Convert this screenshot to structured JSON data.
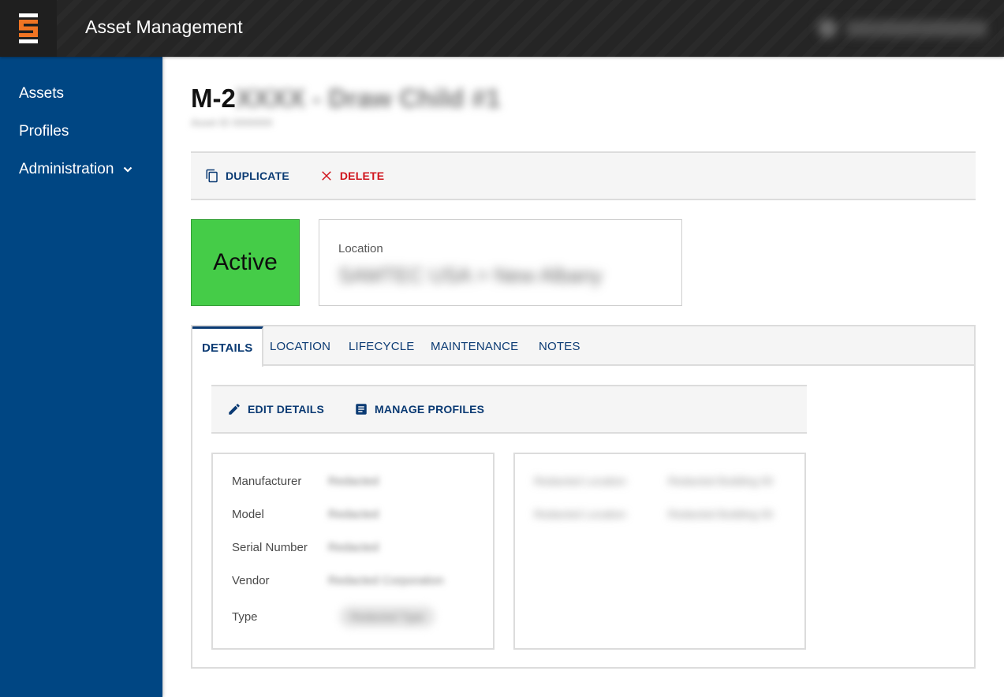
{
  "header": {
    "app_title": "Asset Management",
    "logo_letter": "S",
    "user_name": "User Name (redacted)"
  },
  "colors": {
    "topbar": "#252525",
    "sidebar": "#004683",
    "logo_orange": "#f07423",
    "primary_text": "#0a3a73",
    "danger": "#d0141c",
    "status_active": "#45cc48"
  },
  "sidebar": {
    "items": [
      {
        "label": "Assets",
        "icon": ""
      },
      {
        "label": "Profiles",
        "icon": ""
      },
      {
        "label": "Administration",
        "icon": "chevron-down-icon"
      }
    ]
  },
  "asset": {
    "title_prefix": "M-2",
    "title_redacted": "XXXX - Draw Child #1",
    "subtitle_redacted": "Asset ID 0000000"
  },
  "actions": {
    "duplicate_label": "DUPLICATE",
    "delete_label": "DELETE"
  },
  "status": {
    "label": "Active"
  },
  "location": {
    "label": "Location",
    "value_redacted": "SAMTEC USA > New Albany"
  },
  "tabs": [
    {
      "label": "DETAILS",
      "active": true
    },
    {
      "label": "LOCATION",
      "active": false
    },
    {
      "label": "LIFECYCLE",
      "active": false
    },
    {
      "label": "MAINTENANCE",
      "active": false
    },
    {
      "label": "NOTES",
      "active": false
    }
  ],
  "details_actions": {
    "edit_label": "EDIT DETAILS",
    "manage_profiles_label": "MANAGE PROFILES"
  },
  "details": {
    "fields": [
      {
        "label": "Manufacturer",
        "value": "Redacted"
      },
      {
        "label": "Model",
        "value": "Redacted"
      },
      {
        "label": "Serial Number",
        "value": "Redacted"
      },
      {
        "label": "Vendor",
        "value": "Redacted Corporation"
      },
      {
        "label": "Type",
        "value": "Redacted Type"
      }
    ],
    "extra_fields": [
      {
        "label": "Redacted Location",
        "value": "Redacted Building 00"
      },
      {
        "label": "Redacted Location",
        "value": "Redacted Building 00"
      }
    ]
  }
}
